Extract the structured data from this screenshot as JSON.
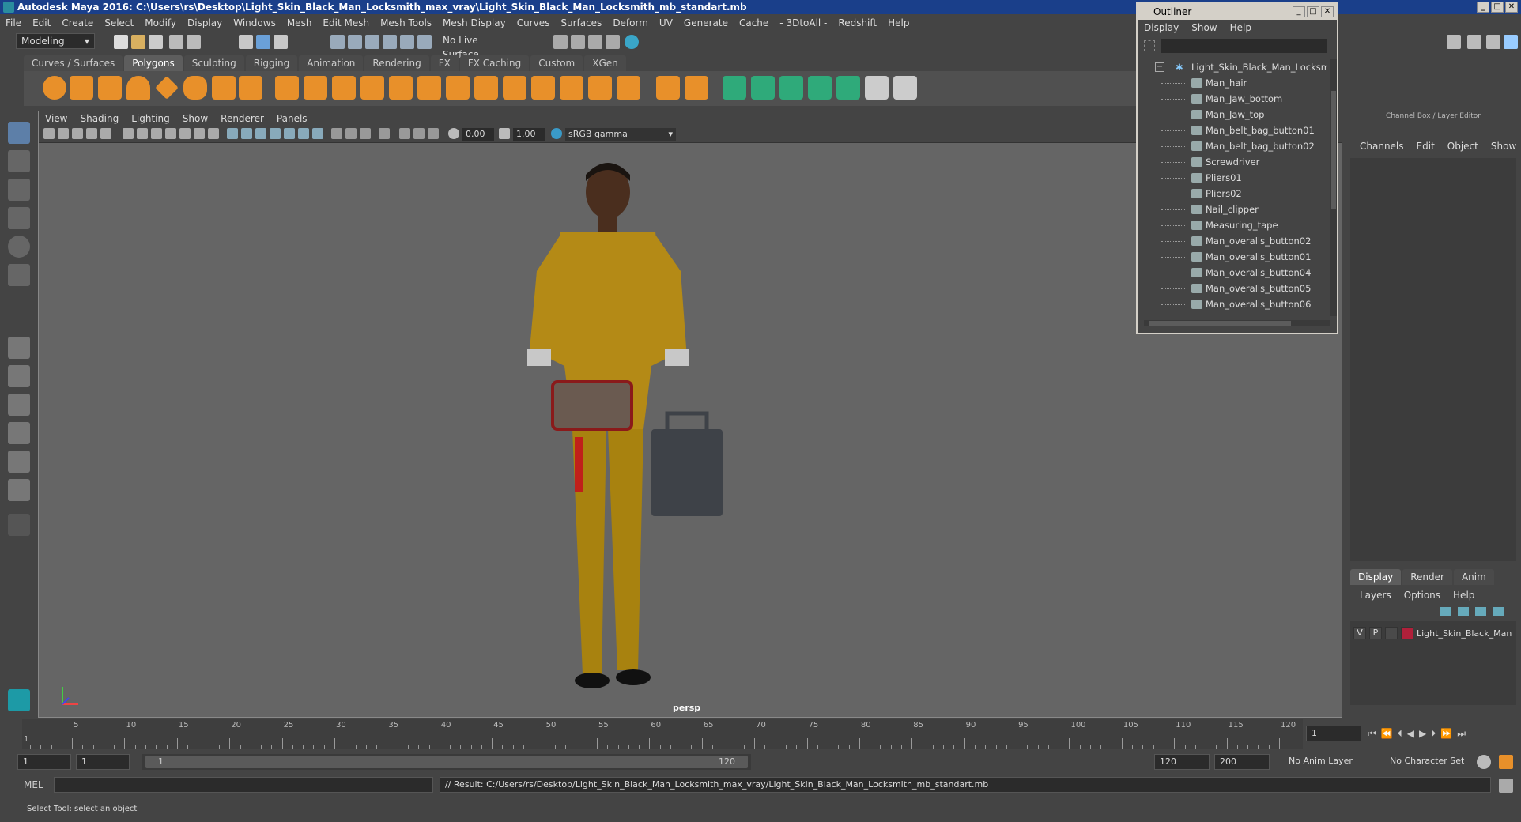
{
  "window": {
    "title": "Autodesk Maya 2016: C:\\Users\\rs\\Desktop\\Light_Skin_Black_Man_Locksmith_max_vray\\Light_Skin_Black_Man_Locksmith_mb_standart.mb"
  },
  "menubar": [
    "File",
    "Edit",
    "Create",
    "Select",
    "Modify",
    "Display",
    "Windows",
    "Mesh",
    "Edit Mesh",
    "Mesh Tools",
    "Mesh Display",
    "Curves",
    "Surfaces",
    "Deform",
    "UV",
    "Generate",
    "Cache",
    "- 3DtoAll -",
    "Redshift",
    "Help"
  ],
  "toolbar": {
    "mode": "Modeling",
    "live_surface": "No Live Surface"
  },
  "shelf_tabs": [
    "Curves / Surfaces",
    "Polygons",
    "Sculpting",
    "Rigging",
    "Animation",
    "Rendering",
    "FX",
    "FX Caching",
    "Custom",
    "XGen"
  ],
  "shelf_active": "Polygons",
  "viewport": {
    "menu": [
      "View",
      "Shading",
      "Lighting",
      "Show",
      "Renderer",
      "Panels"
    ],
    "exposure": "0.00",
    "gamma": "1.00",
    "colorspace": "sRGB gamma",
    "camera": "persp"
  },
  "outliner": {
    "title": "Outliner",
    "menu": [
      "Display",
      "Show",
      "Help"
    ],
    "root": "Light_Skin_Black_Man_Locksmith",
    "items": [
      "Man_hair",
      "Man_Jaw_bottom",
      "Man_Jaw_top",
      "Man_belt_bag_button01",
      "Man_belt_bag_button02",
      "Screwdriver",
      "Pliers01",
      "Pliers02",
      "Nail_clipper",
      "Measuring_tape",
      "Man_overalls_button02",
      "Man_overalls_button01",
      "Man_overalls_button04",
      "Man_overalls_button05",
      "Man_overalls_button06"
    ]
  },
  "channelbox": {
    "title": "Channel Box / Layer Editor",
    "menu": [
      "Channels",
      "Edit",
      "Object",
      "Show"
    ],
    "layer_tabs": [
      "Display",
      "Render",
      "Anim"
    ],
    "layer_menu": [
      "Layers",
      "Options",
      "Help"
    ],
    "layer": {
      "v": "V",
      "p": "P",
      "name": "Light_Skin_Black_Man",
      "color": "#b0203a"
    }
  },
  "timeline": {
    "ticks": [
      "5",
      "10",
      "15",
      "20",
      "25",
      "30",
      "35",
      "40",
      "45",
      "50",
      "55",
      "60",
      "65",
      "70",
      "75",
      "80",
      "85",
      "90",
      "95",
      "100",
      "105",
      "110",
      "115",
      "120"
    ],
    "current_frame": "1",
    "start_marker": "1"
  },
  "range": {
    "start": "1",
    "playback_start": "1",
    "slider_start": "1",
    "slider_end": "120",
    "playback_end": "120",
    "end": "200",
    "anim_layer": "No Anim Layer",
    "char_set": "No Character Set"
  },
  "command": {
    "lang": "MEL",
    "result": "// Result: C:/Users/rs/Desktop/Light_Skin_Black_Man_Locksmith_max_vray/Light_Skin_Black_Man_Locksmith_mb_standart.mb"
  },
  "status": "Select Tool: select an object"
}
